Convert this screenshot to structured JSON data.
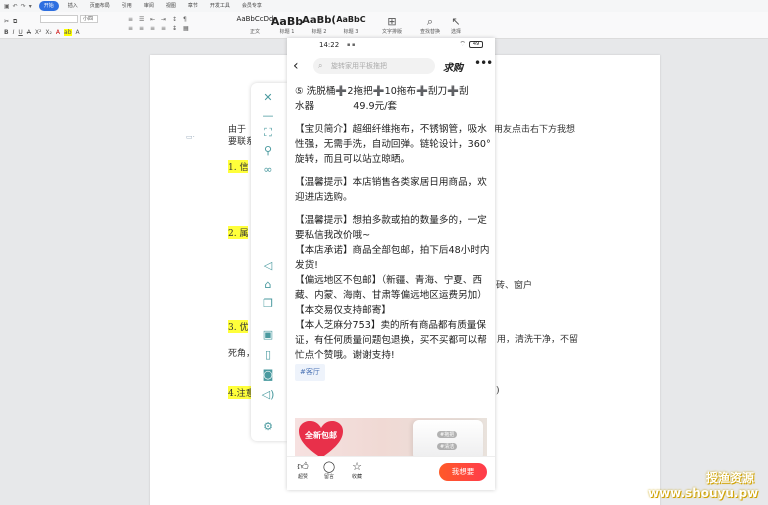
{
  "menubar": {
    "items": [
      "开始",
      "插入",
      "页面布局",
      "引用",
      "审阅",
      "视图",
      "章节",
      "开发工具",
      "会员专享"
    ]
  },
  "ribbon": {
    "font_name": "",
    "font_size": "小四",
    "styles": [
      {
        "sample": "AaBbCcDd",
        "label": "正文"
      },
      {
        "sample": "AaBb",
        "label": "标题 1"
      },
      {
        "sample": "AaBb(",
        "label": "标题 2"
      },
      {
        "sample": "AaBbC",
        "label": "标题 3"
      }
    ],
    "tools": [
      {
        "label": "文字排版",
        "icon": "text-layout-icon"
      },
      {
        "label": "查找替换",
        "icon": "find-icon"
      },
      {
        "label": "选择",
        "icon": "select-icon"
      }
    ]
  },
  "document": {
    "lines": [
      {
        "text": "由于",
        "highlight": false
      },
      {
        "text": "用友点击右下方我想",
        "highlight": false
      },
      {
        "text": "要联系",
        "highlight": false
      },
      {
        "text": "1. 信",
        "highlight": true
      },
      {
        "text": "2. 属",
        "highlight": true
      },
      {
        "text": "砖、窗户",
        "highlight": false
      },
      {
        "text": "3. 优",
        "highlight": true
      },
      {
        "text": "用，清洗干净，不留",
        "highlight": false
      },
      {
        "text": "死角，",
        "highlight": false
      },
      {
        "text": "4.注意",
        "highlight": true
      }
    ]
  },
  "phone": {
    "status": {
      "time": "14:22",
      "battery": "49"
    },
    "search_placeholder": "旋转家用平板拖把",
    "nav_title": "求购",
    "title_line1": "⑤ 洗脱桶➕2拖把➕10拖布➕刮刀➕刮",
    "title_line2a": "水器",
    "title_line2b": "49.9元/套",
    "p1": "【宝贝简介】超细纤维拖布，不锈钢管，吸水性强，无需手洗，自动回弹。链轮设计，360°旋转，而且可以站立晾晒。",
    "p2": "【温馨提示】本店销售各类家居日用商品，欢迎进店选购。",
    "p3": "【温馨提示】想拍多款或拍的数量多的，一定要私信我改价哦~",
    "p4": "【本店承诺】商品全部包邮，拍下后48小时内发货!",
    "p5": "【偏远地区不包邮】（新疆、青海、宁夏、西藏、内蒙、海南、甘肃等偏远地区运费另加）",
    "p6": "【本交易仅支持邮寄】",
    "p7": "【本人芝麻分753】卖的所有商品都有质量保证，有任何质量问题包退换，买不买都可以帮忙点个赞哦。谢谢支持!",
    "tag": "#客厅",
    "promo_badge": "全新包邮",
    "promo_pill1": "#拖把",
    "promo_pill2": "#清洁",
    "bottom": {
      "like": "超赞",
      "comment": "留言",
      "favorite": "收藏",
      "buy": "我想要"
    }
  },
  "watermark": {
    "line1": "授渔资源",
    "line2": "www.shouyu.pw"
  },
  "colors": {
    "accent": "#2e6fe0",
    "highlight": "#ffff3b",
    "buy_button": "#ff4b3a",
    "toolbar_icon": "#4a9a9f"
  }
}
